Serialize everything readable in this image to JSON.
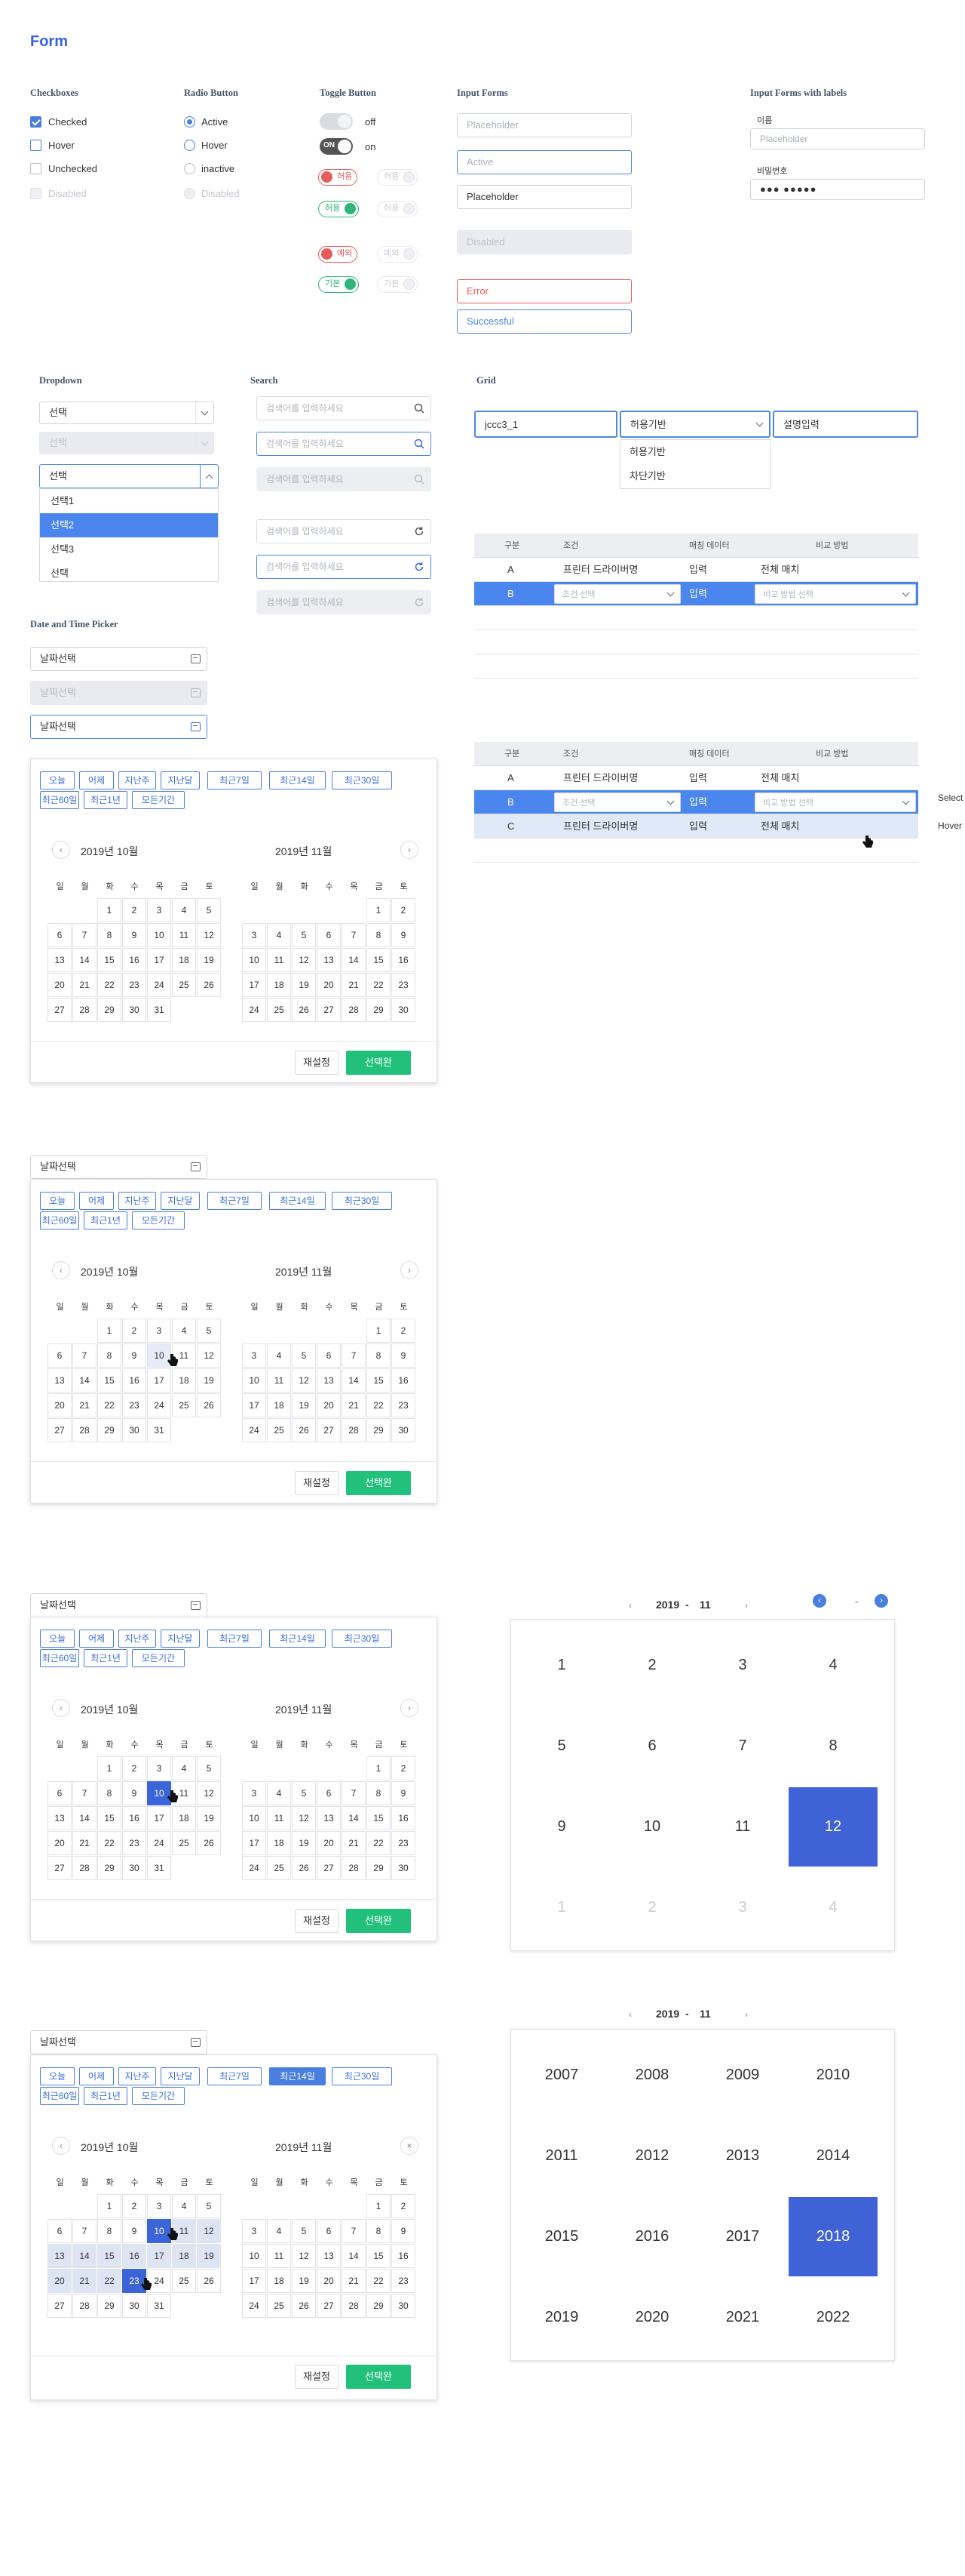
{
  "page_title": "Form",
  "sections": {
    "checkboxes": "Checkboxes",
    "radio": "Radio Button",
    "toggle": "Toggle Button",
    "input": "Input Forms",
    "input_labels": "Input Forms with labels",
    "dropdown": "Dropdown",
    "search": "Search",
    "grid": "Grid",
    "datetime": "Date and Time Picker"
  },
  "checkboxes": [
    "Checked",
    "Hover",
    "Unchecked",
    "Disabled"
  ],
  "radios": [
    "Active",
    "Hover",
    "inactive",
    "Disabled"
  ],
  "toggles": {
    "off": "off",
    "on": "on",
    "on_badge": "ON",
    "pill1": "허용",
    "pill2": "허용",
    "pill3": "허용",
    "pill4": "허용",
    "pill5": "예외",
    "pill6": "예외",
    "pill7": "기본",
    "pill8": "기본"
  },
  "inputs": {
    "placeholder1": "Placeholder",
    "active": "Active",
    "placeholder2": "Placeholder",
    "disabled": "Disabled",
    "error": "Error",
    "success": "Successful"
  },
  "labeled": {
    "name_label": "이름",
    "name_placeholder": "Placeholder",
    "pw_label": "비밀번호",
    "pw_value": "●●● ●●●●●"
  },
  "dropdown": {
    "value": "선택",
    "disabled": "선택",
    "open_value": "선택",
    "options": [
      "선택1",
      "선택2",
      "선택3",
      "선택"
    ]
  },
  "search": {
    "placeholder": "검색어를 입력하세요"
  },
  "grid": {
    "input1": "jccc3_1",
    "select": "허용기반",
    "input2": "설명입력",
    "options": [
      "허용기반",
      "차단기반"
    ]
  },
  "table1": {
    "headers": [
      "구분",
      "조건",
      "매칭 데이터",
      "비교 방법"
    ],
    "rows": [
      {
        "a": "A",
        "b": "프린터 드라이버명",
        "c": "입력",
        "d": "전체 매치"
      },
      {
        "a": "B",
        "b": "조건 선택",
        "c": "입력",
        "d": "비교 방법 선택"
      }
    ]
  },
  "table2": {
    "headers": [
      "구분",
      "조건",
      "매칭 데이터",
      "비교 방법"
    ],
    "rows": [
      {
        "a": "A",
        "b": "프린터 드라이버명",
        "c": "입력",
        "d": "전체 매치"
      },
      {
        "a": "B",
        "b": "조건 선택",
        "c": "입력",
        "d": "비교 방법 선택"
      },
      {
        "a": "C",
        "b": "프린터 드라이버명",
        "c": "입력",
        "d": "전체 매치"
      }
    ],
    "side1": "Select",
    "side2": "Hover"
  },
  "datepicker": {
    "placeholder": "날짜선택",
    "disabled": "날짜선택",
    "active": "날짜선택"
  },
  "quick": [
    "오늘",
    "어제",
    "지난주",
    "지난달",
    "최근7일",
    "최근14일",
    "최근30일",
    "최근60일",
    "최근1년",
    "모든기간"
  ],
  "months": [
    "2019년 10월",
    "2019년 11월"
  ],
  "weekdays": [
    "일",
    "월",
    "화",
    "수",
    "목",
    "금",
    "토"
  ],
  "buttons": {
    "reset": "재설정",
    "done": "선택완"
  },
  "month_picker": {
    "year": "2019",
    "month": "11",
    "sep": "-",
    "cells": [
      "1",
      "2",
      "3",
      "4",
      "5",
      "6",
      "7",
      "8",
      "9",
      "10",
      "11",
      "12",
      "1",
      "2",
      "3",
      "4"
    ]
  },
  "year_picker": {
    "year": "2019",
    "month": "11",
    "sep": "-",
    "cells": [
      "2007",
      "2008",
      "2009",
      "2010",
      "2011",
      "2012",
      "2013",
      "2014",
      "2015",
      "2016",
      "2017",
      "2018",
      "2019",
      "2020",
      "2021",
      "2022"
    ]
  }
}
